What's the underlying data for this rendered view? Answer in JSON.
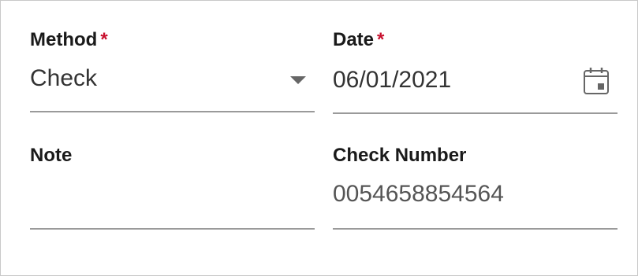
{
  "form": {
    "method": {
      "label": "Method",
      "required_mark": "*",
      "value": "Check"
    },
    "date": {
      "label": "Date",
      "required_mark": "*",
      "value": "06/01/2021"
    },
    "note": {
      "label": "Note",
      "value": ""
    },
    "check_number": {
      "label": "Check Number",
      "value": "0054658854564"
    }
  },
  "icons": {
    "method_dropdown": "chevron-down-icon",
    "date_picker": "calendar-icon"
  },
  "colors": {
    "required": "#c8102e",
    "label_text": "#1a1a1a",
    "value_text": "#333333",
    "muted_value_text": "#555555",
    "underline": "#9a9a9a",
    "icon": "#666666"
  }
}
